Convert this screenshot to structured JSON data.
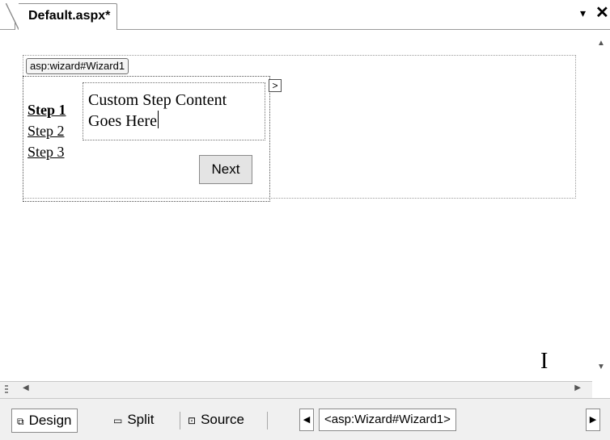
{
  "tab": {
    "title": "Default.aspx*"
  },
  "window": {
    "dropdown_icon": "▾",
    "close_icon": "✕"
  },
  "designer": {
    "wizard_tag": "asp:wizard#Wizard1",
    "smart_tag_icon": ">",
    "steps": [
      "Step 1",
      "Step 2",
      "Step 3"
    ],
    "active_step": "Step 1",
    "content_line1": "Custom Step Content",
    "content_line2": "Goes Here",
    "next_button": "Next"
  },
  "views": {
    "design": {
      "label": "Design",
      "icon": "design-icon"
    },
    "split": {
      "label": "Split",
      "icon": "split-icon"
    },
    "source": {
      "label": "Source",
      "icon": "source-icon"
    },
    "selected": "Design"
  },
  "breadcrumb": {
    "label": "<asp:Wizard#Wizard1>"
  }
}
